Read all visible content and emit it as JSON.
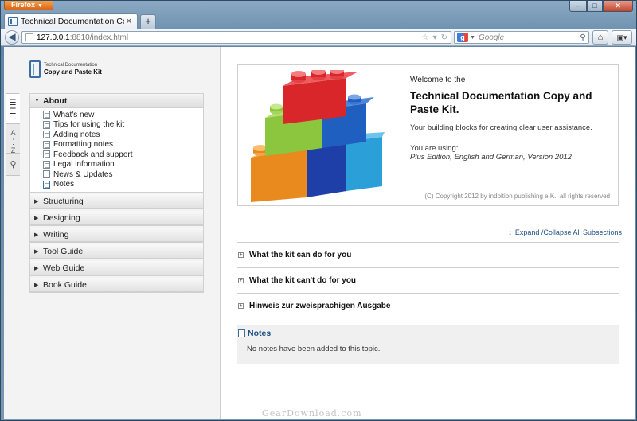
{
  "browser": {
    "menu_button": "Firefox",
    "tab_title": "Technical Documentation Copy and Pas...",
    "new_tab": "+",
    "url_host": "127.0.0.1",
    "url_rest": ":8810/index.html",
    "search_placeholder": "Google",
    "window_controls": {
      "minimize": "–",
      "maximize": "□",
      "close": "✕"
    }
  },
  "logo": {
    "small": "Technical Documentation",
    "big": "Copy and Paste Kit"
  },
  "vertical_tabs": {
    "index_letters": "A\n⋮\nZ"
  },
  "toc": {
    "open_section": "About",
    "items": [
      "What's new",
      "Tips for using the kit",
      "Adding notes",
      "Formatting notes",
      "Feedback and support",
      "Legal information",
      "News & Updates",
      "Notes"
    ],
    "sections": [
      "Structuring",
      "Designing",
      "Writing",
      "Tool Guide",
      "Web Guide",
      "Book Guide"
    ]
  },
  "welcome": {
    "line1": "Welcome to the",
    "title": "Technical Documentation Copy and Paste Kit.",
    "description": "Your building blocks for creating clear user assistance.",
    "using_label": "You are using:",
    "using_value": "Plus Edition, English and German, Version 2012",
    "copyright": "(C) Copyright 2012 by indoition publishing e.K., all rights reserved"
  },
  "expand_link": "Expand /Collapse All Subsections",
  "subsections": [
    "What the kit can do for you",
    "What the kit can't do for you",
    "Hinweis zur zweisprachigen Ausgabe"
  ],
  "notes": {
    "title": "Notes",
    "text": "No notes have been added to this topic."
  },
  "watermark": "GearDownload.com",
  "colors": {
    "brick_red": "#d8262a",
    "brick_green": "#8cc63f",
    "brick_blue": "#1f5fbf",
    "brick_cyan": "#2a9fd8",
    "brick_orange": "#e98a1e",
    "link": "#1f4f86"
  }
}
